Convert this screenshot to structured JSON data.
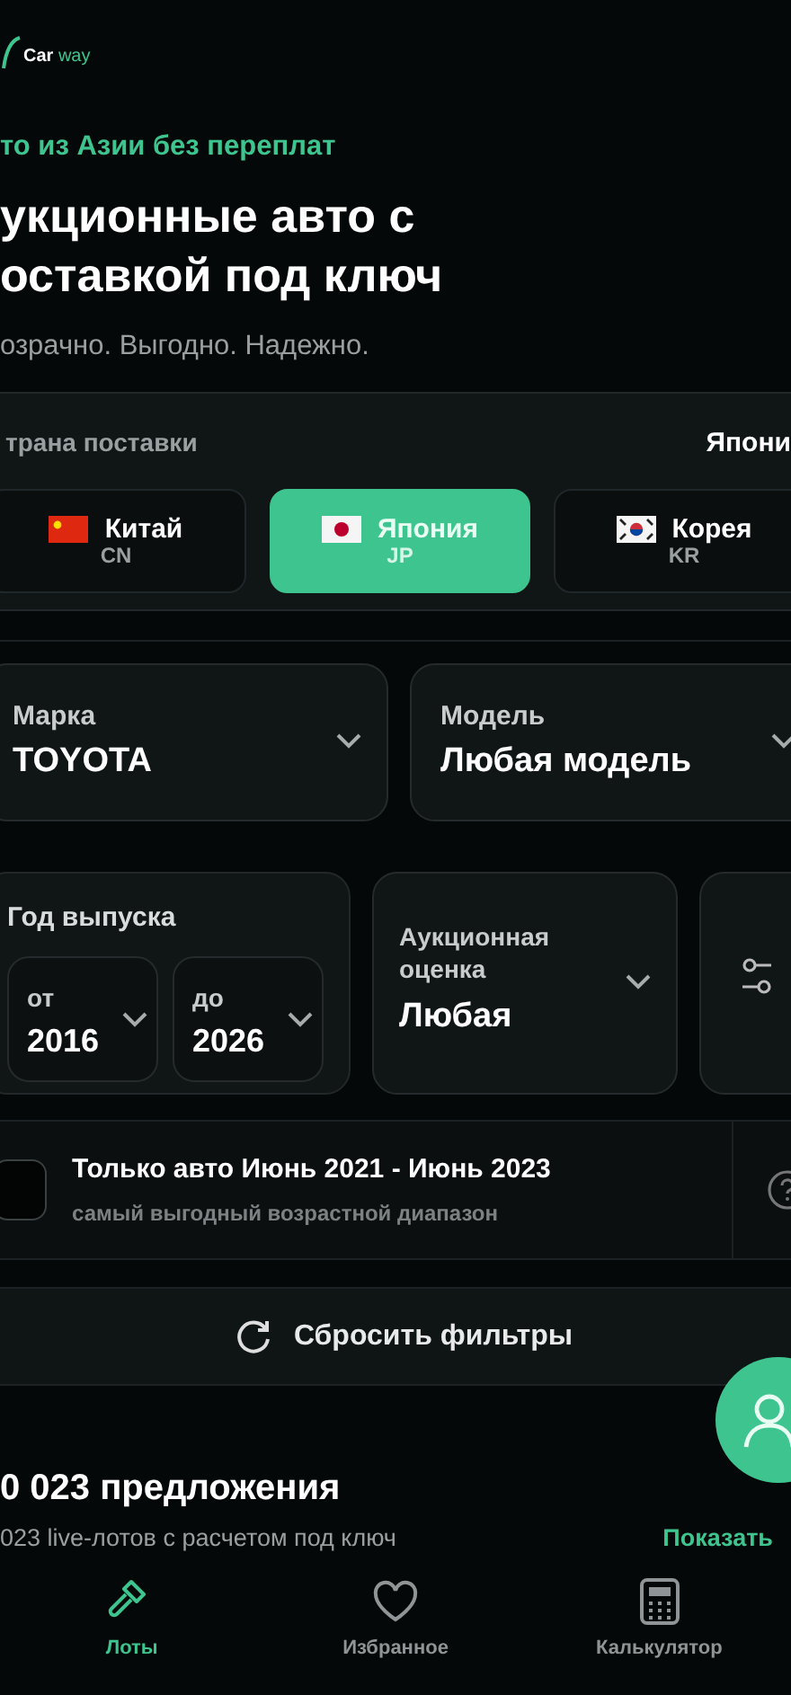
{
  "logo": {
    "name": "Car",
    "accent": "way"
  },
  "hero": {
    "eyebrow": "то из Азии без переплат",
    "title_lines": [
      "укционные авто с",
      "оставкой под ключ"
    ],
    "subtitle": "озрачно. Выгодно. Надежно."
  },
  "country": {
    "label": "трана поставки",
    "current": "Япони",
    "options": [
      {
        "name": "Китай",
        "code": "CN",
        "selected": false
      },
      {
        "name": "Япония",
        "code": "JP",
        "selected": true
      },
      {
        "name": "Корея",
        "code": "KR",
        "selected": false
      }
    ]
  },
  "filters": {
    "brand": {
      "label": "Марка",
      "value": "TOYOTA"
    },
    "model": {
      "label": "Модель",
      "value": "Любая модель"
    },
    "year": {
      "label": "Год выпуска",
      "from": {
        "label": "от",
        "value": "2016"
      },
      "to": {
        "label": "до",
        "value": "2026"
      }
    },
    "grade": {
      "label": "Аукционная оценка",
      "value": "Любая"
    },
    "age_range": {
      "title": "Только авто Июнь 2021 - Июнь 2023",
      "hint": "самый выгодный возрастной диапазон",
      "checked": false
    },
    "reset": "Сбросить фильтры"
  },
  "results": {
    "count": "0 023 предложения",
    "subtitle": "023 live-лотов с расчетом под ключ",
    "link": "Показать"
  },
  "nav": [
    {
      "label": "Лоты",
      "selected": true
    },
    {
      "label": "Избранное",
      "selected": false
    },
    {
      "label": "Калькулятор",
      "selected": false
    }
  ]
}
